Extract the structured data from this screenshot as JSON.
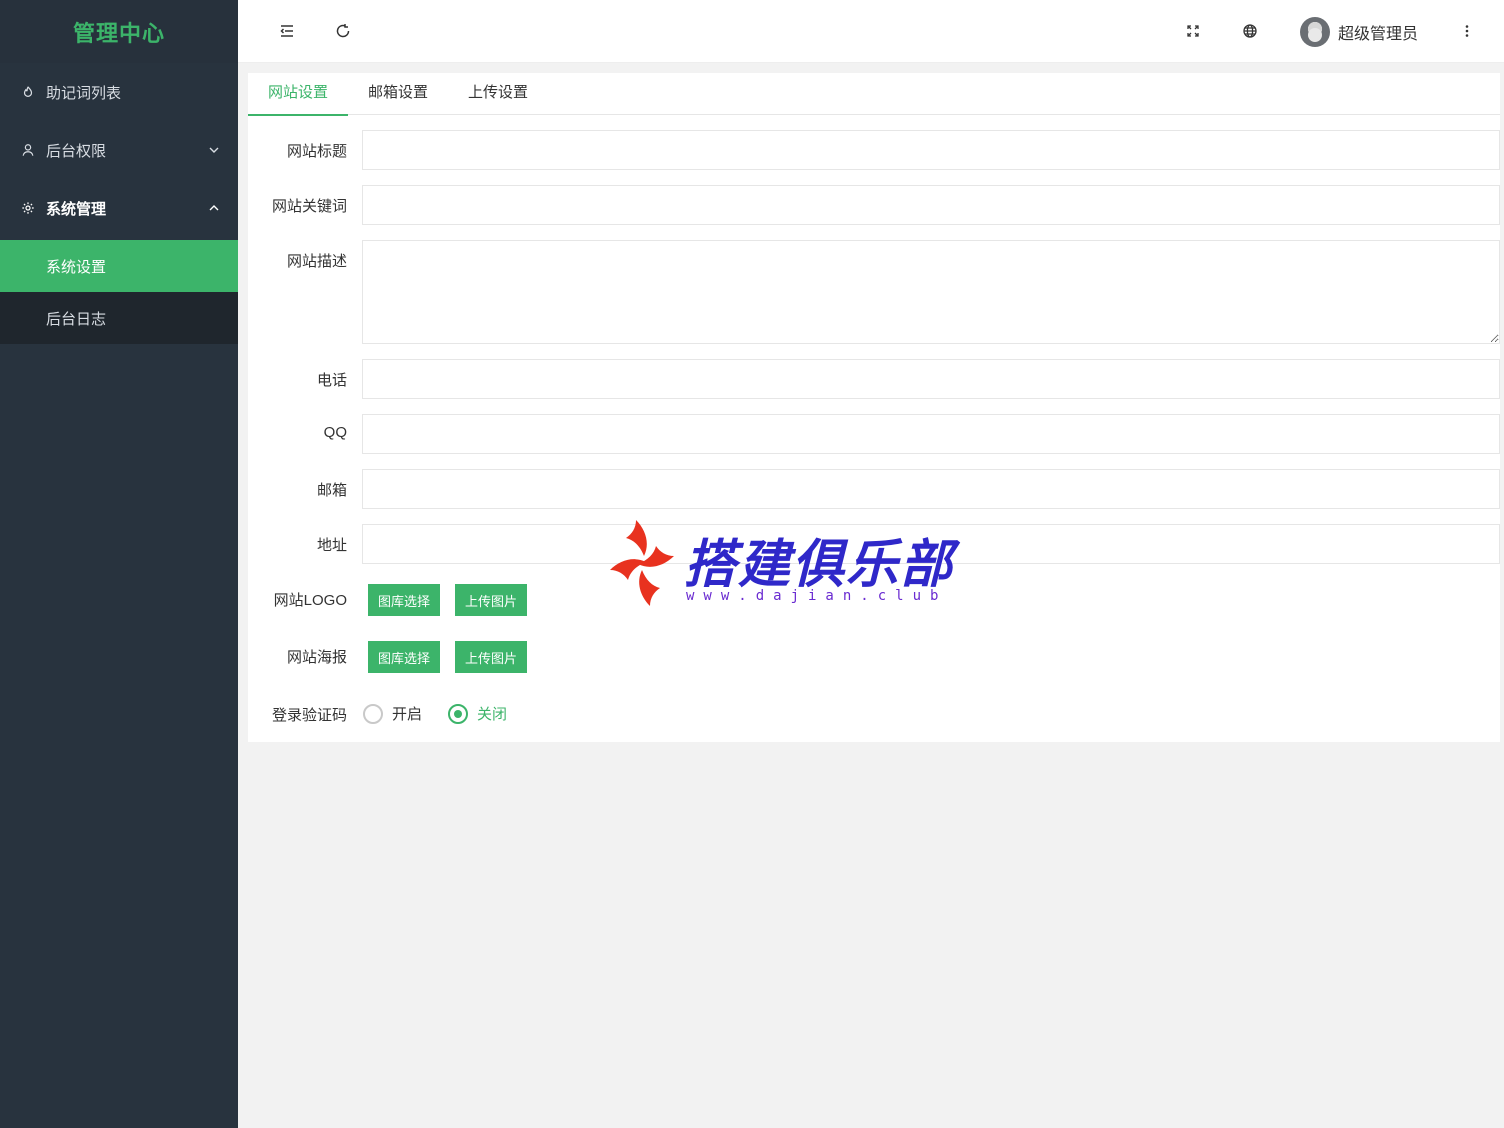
{
  "sidebar": {
    "logo": "管理中心",
    "menu": [
      {
        "label": "助记词列表",
        "icon": "fire-icon"
      },
      {
        "label": "后台权限",
        "icon": "user-icon",
        "expandable": true,
        "expanded": false
      },
      {
        "label": "系统管理",
        "icon": "gear-icon",
        "expandable": true,
        "expanded": true
      }
    ],
    "submenu": [
      {
        "label": "系统设置",
        "active": true
      },
      {
        "label": "后台日志",
        "active": false
      }
    ]
  },
  "header": {
    "icons": [
      "menu-fold-icon",
      "refresh-icon",
      "fullscreen-icon",
      "globe-icon",
      "more-vertical-icon"
    ],
    "user_name": "超级管理员"
  },
  "tabs": [
    {
      "label": "网站设置",
      "active": true
    },
    {
      "label": "邮箱设置",
      "active": false
    },
    {
      "label": "上传设置",
      "active": false
    }
  ],
  "form": {
    "site_title_label": "网站标题",
    "site_keywords_label": "网站关键词",
    "site_description_label": "网站描述",
    "phone_label": "电话",
    "qq_label": "QQ",
    "email_label": "邮箱",
    "address_label": "地址",
    "logo_label": "网站LOGO",
    "poster_label": "网站海报",
    "captcha_label": "登录验证码",
    "gallery_button": "图库选择",
    "upload_button": "上传图片",
    "captcha_on": "开启",
    "captcha_off": "关闭",
    "captcha_value": "关闭"
  },
  "watermark": {
    "title": "搭建俱乐部",
    "url": "www.dajian.club"
  },
  "colors": {
    "accent": "#3cb46a",
    "sidebar_bg": "#28333e",
    "watermark_blue": "#2f28c9",
    "watermark_red": "#e8321f"
  }
}
